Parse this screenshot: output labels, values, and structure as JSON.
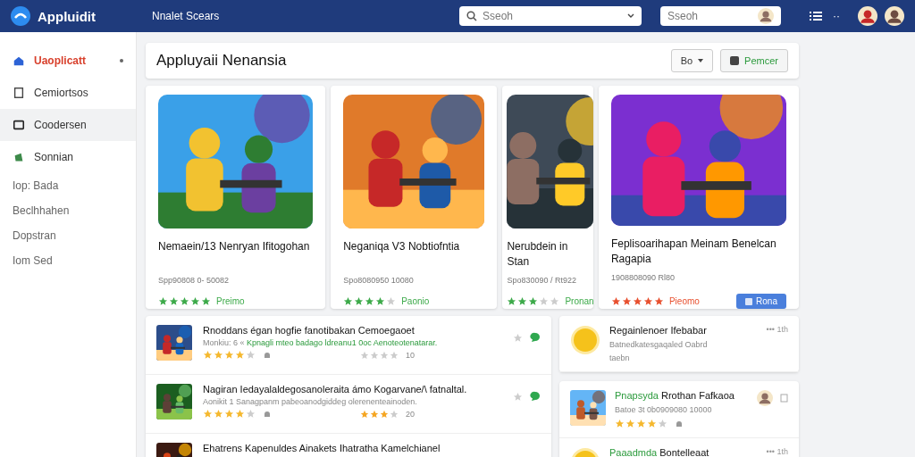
{
  "header": {
    "app_name": "Appluidit",
    "section": "Nnalet Scears",
    "search": {
      "placeholder": "Sseoh"
    },
    "search_2": {
      "placeholder": "Sseoh"
    },
    "more": "··"
  },
  "sidebar": {
    "items": [
      {
        "label": "Uaoplicatt",
        "kind": "icon",
        "selected": true,
        "highlighted": false
      },
      {
        "label": "Cemiortsos",
        "kind": "icon",
        "selected": false,
        "highlighted": false
      },
      {
        "label": "Coodersen",
        "kind": "icon",
        "selected": false,
        "highlighted": true
      },
      {
        "label": "Sonnian",
        "kind": "icon",
        "selected": false,
        "highlighted": false
      },
      {
        "label": "Iop: Bada",
        "kind": "text",
        "selected": false,
        "highlighted": false
      },
      {
        "label": "Beclhhahen",
        "kind": "text",
        "selected": false,
        "highlighted": false
      },
      {
        "label": "Dopstran",
        "kind": "text",
        "selected": false,
        "highlighted": false
      },
      {
        "label": "Iom Sed",
        "kind": "text",
        "selected": false,
        "highlighted": false
      }
    ]
  },
  "page": {
    "title": "Appluyaii Nenansia",
    "sort_button": "Bo",
    "action_button": "Pemcer"
  },
  "cards": [
    {
      "title": "Nemaein/13 Nenryan Ifitogohan",
      "meta": "Spp90808 0- 50082",
      "stars": 5,
      "color": "#3daa4a",
      "label": "Preimo"
    },
    {
      "title": "Neganiqa V3 Nobtiofntia",
      "meta": "Spo8080950 10080",
      "stars": 4,
      "color": "#3daa4a",
      "label": "Paonio"
    },
    {
      "title": "Nerubdein in Stan",
      "meta": "Spo830090 / Rt922",
      "stars": 3,
      "color": "#3daa4a",
      "label": "Pronan"
    },
    {
      "title": "Feplisoarihapan Meinam Benelcan Ragapia",
      "meta": "1908808090 Rl80",
      "stars": 5,
      "color": "#e8502f",
      "label": "Pieomo",
      "button": "Rona"
    }
  ],
  "list": [
    {
      "title": "Rnoddans égan hogfie fanotibakan Cemoegaoet",
      "subtitle": "Monkiu: 6 «",
      "highlight": "Kpnagli mteo badago ldreanu1 0oc Aenoteotenatarar.",
      "stars": 4,
      "review": {
        "stars": 0,
        "count": "10"
      }
    },
    {
      "title": "Nagiran Iedayalaldegosanoleraita ámo Kogarvane/\\ fatnaltal.",
      "subtitle": "Aonikit 1 Sanagpanm pabeoanodgiddeg olerenenteainoden.",
      "stars": 4,
      "review": {
        "stars": 3,
        "count": "20"
      }
    },
    {
      "title": "Ehatrens Kapenuldes Ainakets Ihatratha Kamelchianel"
    }
  ],
  "feed": [
    {
      "kind": "notice",
      "title": "Regainlenoer Ifebabar",
      "subtitle": "Batnedkatesgaqaled Oabrd",
      "note": "taebn",
      "time": "••• 1th"
    },
    {
      "kind": "game",
      "tag": "Pnapsyda",
      "title": "Rrothan Fafkaoa",
      "subtitle": "Batoe 3t 0b0909080 10000",
      "stars": 4
    },
    {
      "kind": "notice",
      "tag": "Paaadmda",
      "title": "Bontelleaat",
      "time": "••• 1th"
    }
  ]
}
